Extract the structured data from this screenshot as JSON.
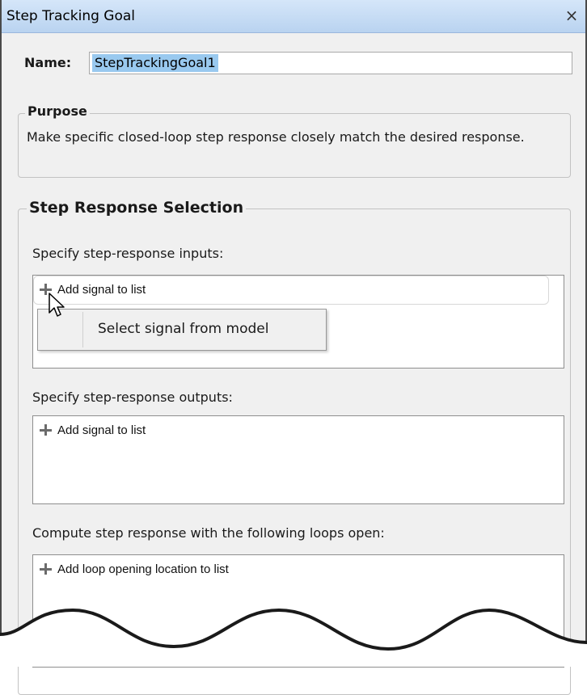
{
  "window": {
    "title": "Step Tracking Goal",
    "close_icon": "×"
  },
  "name": {
    "label": "Name:",
    "value": "StepTrackingGoal1"
  },
  "purpose": {
    "legend": "Purpose",
    "text": "Make specific closed-loop step response closely match the desired response."
  },
  "step_response": {
    "legend": "Step Response Selection",
    "inputs": {
      "label": "Specify step-response inputs:",
      "add_label": "Add signal to list"
    },
    "context_menu": {
      "item": "Select signal from model"
    },
    "outputs": {
      "label": "Specify step-response outputs:",
      "add_label": "Add signal to list"
    },
    "loops": {
      "label": "Compute step response with the following loops open:",
      "add_label": "Add loop opening location to list"
    }
  },
  "icons": [
    "plus-icon",
    "close-icon",
    "mouse-pointer-icon"
  ]
}
